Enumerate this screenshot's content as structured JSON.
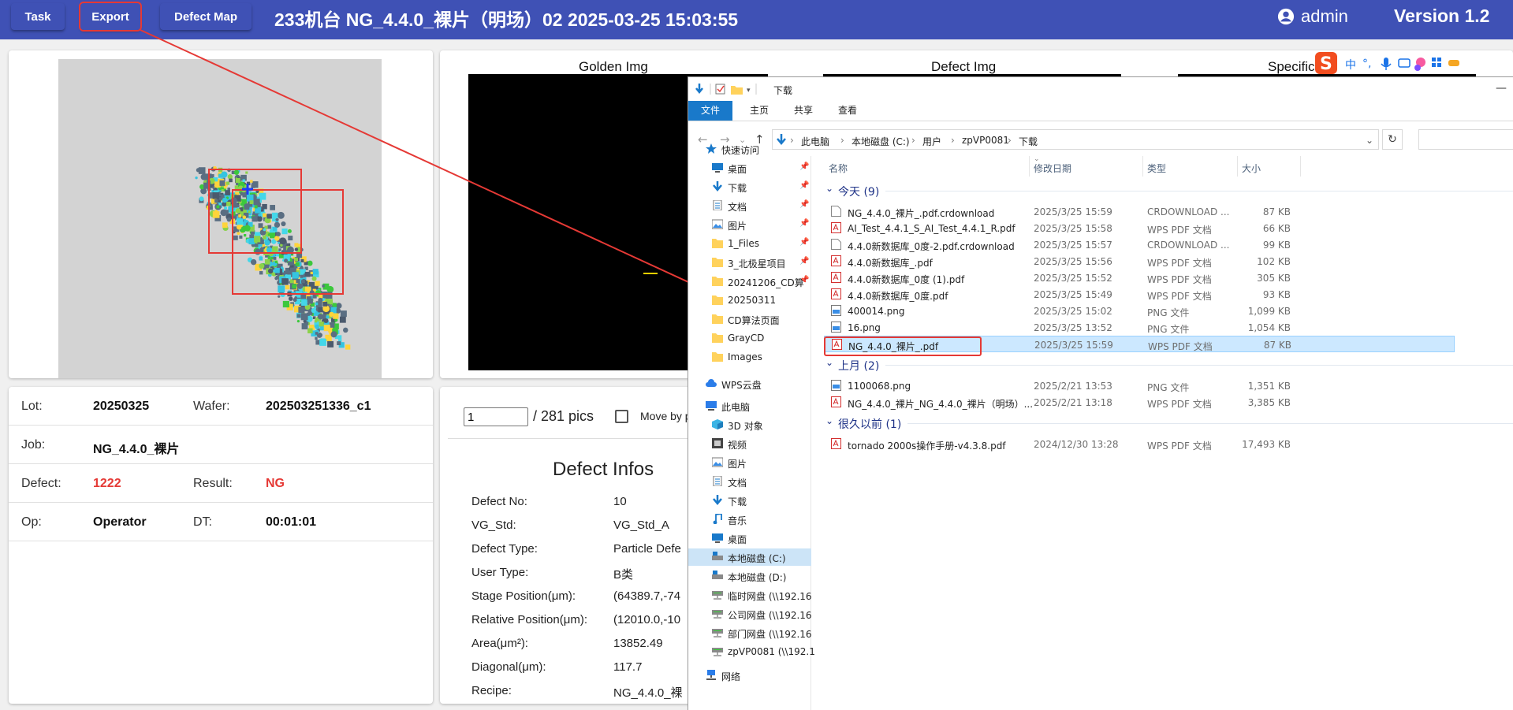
{
  "topbar": {
    "task_label": "Task",
    "export_label": "Export",
    "defect_map_label": "Defect Map",
    "title": "233机台   NG_4.4.0_裸片（明场）02   2025-03-25 15:03:55",
    "user": "admin",
    "version": "Version 1.2"
  },
  "images": {
    "golden": "Golden Img",
    "defect": "Defect Img",
    "specific": "Specific"
  },
  "info": {
    "lot_label": "Lot:",
    "lot": "20250325",
    "wafer_label": "Wafer:",
    "wafer": "202503251336_c1",
    "job_label": "Job:",
    "job": "NG_4.4.0_裸片",
    "defect_label": "Defect:",
    "defect": "1222",
    "result_label": "Result:",
    "result": "NG",
    "op_label": "Op:",
    "op": "Operator",
    "dt_label": "DT:",
    "dt": "00:01:01"
  },
  "pager": {
    "current": "1",
    "total": "/ 281 pics",
    "move_label": "Move by p"
  },
  "defect_infos": {
    "title": "Defect Infos",
    "rows": [
      {
        "label": "Defect No:",
        "value": "10"
      },
      {
        "label": "VG_Std:",
        "value": "VG_Std_A"
      },
      {
        "label": "Defect Type:",
        "value": "Particle Defe"
      },
      {
        "label": "User Type:",
        "value": "B类"
      },
      {
        "label": "Stage Position(μm):",
        "value": "(64389.7,-74"
      },
      {
        "label": "Relative Position(μm):",
        "value": "(12010.0,-10"
      },
      {
        "label": "Area(μm²):",
        "value": "13852.49"
      },
      {
        "label": "Diagonal(μm):",
        "value": "117.7"
      },
      {
        "label": "Recipe:",
        "value": "NG_4.4.0_裸"
      }
    ]
  },
  "explorer": {
    "title": "下载",
    "tabs": [
      "文件",
      "主页",
      "共享",
      "查看"
    ],
    "breadcrumb": [
      "此电脑",
      "本地磁盘 (C:)",
      "用户",
      "zpVP0081",
      "下载"
    ],
    "columns": {
      "name": "名称",
      "date": "修改日期",
      "type": "类型",
      "size": "大小"
    },
    "nav": [
      {
        "label": "快速访问",
        "icon": "star-icon",
        "pin": false
      },
      {
        "label": "桌面",
        "icon": "desktop-icon",
        "pin": true
      },
      {
        "label": "下载",
        "icon": "download-icon",
        "pin": true
      },
      {
        "label": "文档",
        "icon": "document-icon",
        "pin": true
      },
      {
        "label": "图片",
        "icon": "picture-icon",
        "pin": true
      },
      {
        "label": "1_Files",
        "icon": "folder-icon",
        "pin": true
      },
      {
        "label": "3_北极星项目",
        "icon": "folder-icon",
        "pin": true
      },
      {
        "label": "20241206_CD算",
        "icon": "folder-icon",
        "pin": true
      },
      {
        "label": "20250311",
        "icon": "folder-icon",
        "pin": false
      },
      {
        "label": "CD算法页面",
        "icon": "folder-icon",
        "pin": false
      },
      {
        "label": "GrayCD",
        "icon": "folder-icon",
        "pin": false
      },
      {
        "label": "Images",
        "icon": "folder-icon",
        "pin": false
      },
      {
        "label": "WPS云盘",
        "icon": "cloud-icon",
        "pin": false
      },
      {
        "label": "此电脑",
        "icon": "computer-icon",
        "pin": false
      },
      {
        "label": "3D 对象",
        "icon": "cube-icon",
        "pin": false
      },
      {
        "label": "视频",
        "icon": "video-icon",
        "pin": false
      },
      {
        "label": "图片",
        "icon": "picture-icon",
        "pin": false
      },
      {
        "label": "文档",
        "icon": "document-icon",
        "pin": false
      },
      {
        "label": "下载",
        "icon": "download-icon",
        "pin": false
      },
      {
        "label": "音乐",
        "icon": "music-icon",
        "pin": false
      },
      {
        "label": "桌面",
        "icon": "desktop-icon",
        "pin": false
      },
      {
        "label": "本地磁盘 (C:)",
        "icon": "drive-icon",
        "pin": false
      },
      {
        "label": "本地磁盘 (D:)",
        "icon": "drive-icon",
        "pin": false
      },
      {
        "label": "临时网盘 (\\\\192.16",
        "icon": "network-drive-icon",
        "pin": false
      },
      {
        "label": "公司网盘 (\\\\192.16",
        "icon": "network-drive-icon",
        "pin": false
      },
      {
        "label": "部门网盘 (\\\\192.16",
        "icon": "network-drive-icon",
        "pin": false
      },
      {
        "label": "zpVP0081 (\\\\192.1",
        "icon": "network-drive-icon",
        "pin": false
      },
      {
        "label": "网络",
        "icon": "network-icon",
        "pin": false
      }
    ],
    "groups": [
      {
        "label": "今天 (9)",
        "files": [
          {
            "name": "NG_4.4.0_裸片_.pdf.crdownload",
            "date": "2025/3/25 15:59",
            "type": "CRDOWNLOAD ...",
            "size": "87 KB",
            "icon": "file-icon"
          },
          {
            "name": "AI_Test_4.4.1_S_AI_Test_4.4.1_R.pdf",
            "date": "2025/3/25 15:58",
            "type": "WPS PDF 文档",
            "size": "66 KB",
            "icon": "pdf-icon"
          },
          {
            "name": "4.4.0新数据库_0度-2.pdf.crdownload",
            "date": "2025/3/25 15:57",
            "type": "CRDOWNLOAD ...",
            "size": "99 KB",
            "icon": "file-icon"
          },
          {
            "name": "4.4.0新数据库_.pdf",
            "date": "2025/3/25 15:56",
            "type": "WPS PDF 文档",
            "size": "102 KB",
            "icon": "pdf-icon"
          },
          {
            "name": "4.4.0新数据库_0度 (1).pdf",
            "date": "2025/3/25 15:52",
            "type": "WPS PDF 文档",
            "size": "305 KB",
            "icon": "pdf-icon"
          },
          {
            "name": "4.4.0新数据库_0度.pdf",
            "date": "2025/3/25 15:49",
            "type": "WPS PDF 文档",
            "size": "93 KB",
            "icon": "pdf-icon"
          },
          {
            "name": "400014.png",
            "date": "2025/3/25 15:02",
            "type": "PNG 文件",
            "size": "1,099 KB",
            "icon": "image-file-icon"
          },
          {
            "name": "16.png",
            "date": "2025/3/25 13:52",
            "type": "PNG 文件",
            "size": "1,054 KB",
            "icon": "image-file-icon"
          },
          {
            "name": "NG_4.4.0_裸片_.pdf",
            "date": "2025/3/25 15:59",
            "type": "WPS PDF 文档",
            "size": "87 KB",
            "icon": "pdf-icon",
            "selected": true
          }
        ]
      },
      {
        "label": "上月 (2)",
        "files": [
          {
            "name": "1100068.png",
            "date": "2025/2/21 13:53",
            "type": "PNG 文件",
            "size": "1,351 KB",
            "icon": "image-file-icon"
          },
          {
            "name": "NG_4.4.0_裸片_NG_4.4.0_裸片（明场）...",
            "date": "2025/2/21 13:18",
            "type": "WPS PDF 文档",
            "size": "3,385 KB",
            "icon": "pdf-icon"
          }
        ]
      },
      {
        "label": "很久以前 (1)",
        "files": [
          {
            "name": "tornado 2000s操作手册-v4.3.8.pdf",
            "date": "2024/12/30 13:28",
            "type": "WPS PDF 文档",
            "size": "17,493 KB",
            "icon": "pdf-icon"
          }
        ]
      }
    ]
  },
  "ime": {
    "mode": "中"
  },
  "colors": {
    "header": "#3f51b5",
    "highlight": "#e53935",
    "ng_red": "#e53935",
    "selection": "#cce8ff"
  }
}
